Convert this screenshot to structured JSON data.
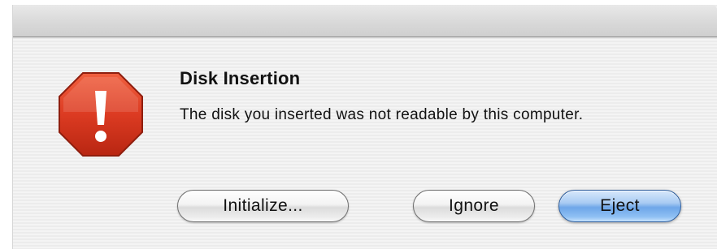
{
  "dialog": {
    "heading": "Disk Insertion",
    "message": "The disk you inserted was not readable by this computer.",
    "icon": "alert-octagon-icon",
    "buttons": {
      "initialize": "Initialize...",
      "ignore": "Ignore",
      "eject": "Eject"
    },
    "default_button": "eject",
    "colors": {
      "alert_red": "#d93a22",
      "default_button_blue": "#6ea6e8"
    }
  }
}
